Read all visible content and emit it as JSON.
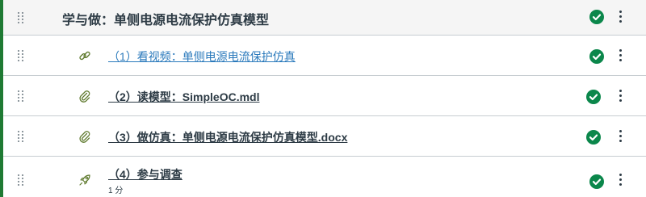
{
  "module": {
    "title": "学与做：单侧电源电流保护仿真模型",
    "completed_icon": "check-circle-icon",
    "accent_color": "#0b874b"
  },
  "items": [
    {
      "label": "（1）看视频：单侧电源电流保护仿真",
      "type_icon": "link-icon",
      "meta": ""
    },
    {
      "label": "（2）读模型：SimpleOC.mdl",
      "type_icon": "paperclip-icon",
      "meta": ""
    },
    {
      "label": "（3）做仿真：单侧电源电流保护仿真模型.docx",
      "type_icon": "paperclip-icon",
      "meta": ""
    },
    {
      "label": "（4）参与调查",
      "type_icon": "rocket-icon",
      "meta": "1 分"
    }
  ]
}
